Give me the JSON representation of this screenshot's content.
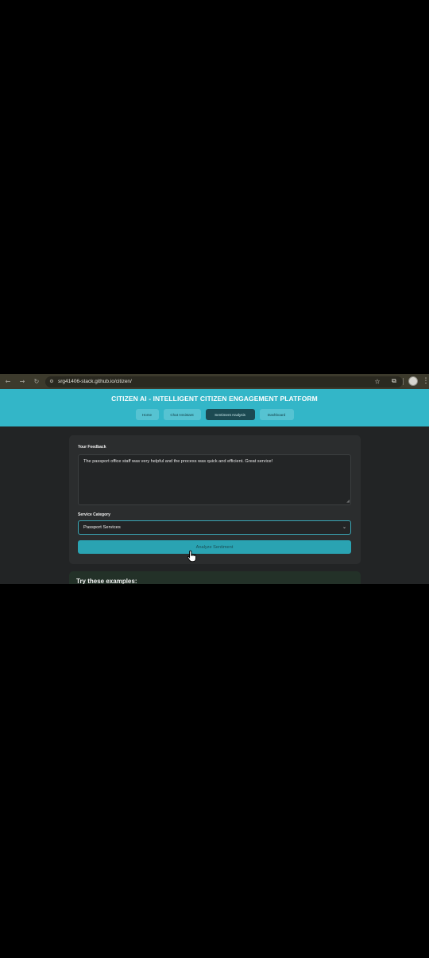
{
  "browser": {
    "url": "srg41406-stack.github.io/citizen/",
    "icons": [
      "back-arrow-icon",
      "forward-arrow-icon",
      "reload-icon",
      "site-info-icon",
      "bookmark-star-icon",
      "extensions-icon",
      "profile-avatar-icon",
      "more-menu-icon"
    ]
  },
  "header": {
    "title": "CITIZEN AI - INTELLIGENT CITIZEN ENGAGEMENT PLATFORM",
    "tabs": [
      {
        "label": "Home",
        "active": false
      },
      {
        "label": "Chat Assistant",
        "active": false
      },
      {
        "label": "Sentiment Analysis",
        "active": true
      },
      {
        "label": "Dashboard",
        "active": false
      }
    ]
  },
  "form": {
    "feedback_label": "Your Feedback",
    "feedback_value": "The passport office staff was very helpful and the process was quick and efficient. Great service!",
    "category_label": "Service Category",
    "category_value": "Passport Services",
    "analyze_label": "Analyze Sentiment"
  },
  "examples": {
    "title": "Try these examples:"
  },
  "colors": {
    "header": "#33b6c8",
    "active_tab": "#1c4a52",
    "button": "#2aa3b2",
    "page_bg": "#222425"
  }
}
